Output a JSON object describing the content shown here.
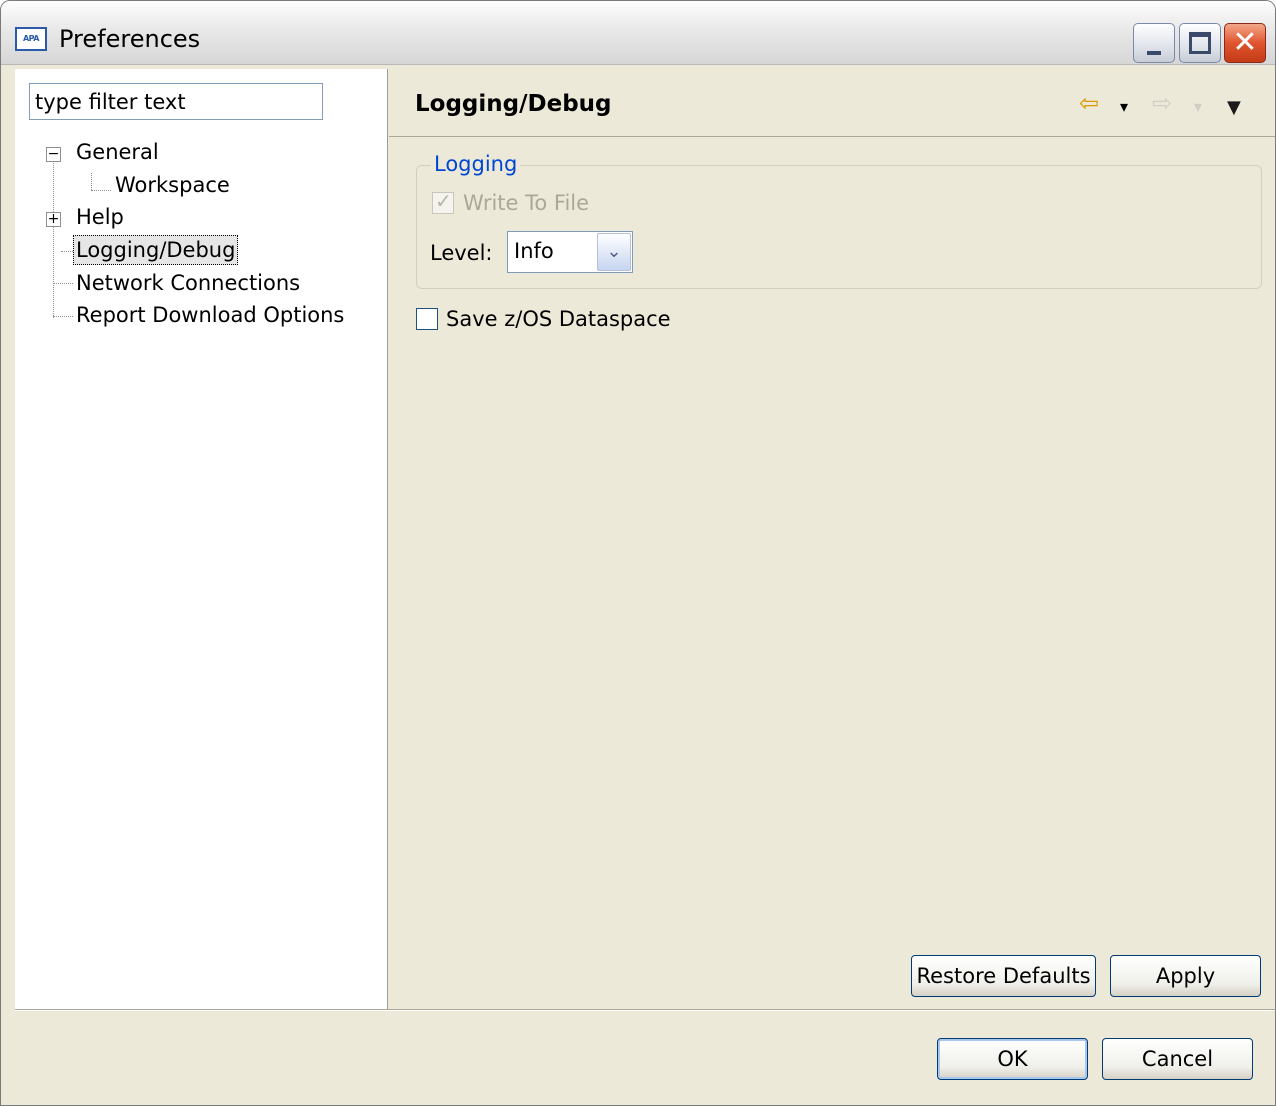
{
  "window": {
    "title": "Preferences",
    "icon_text": "APA",
    "controls": {
      "minimize": "_",
      "maximize": "□",
      "close": "✕"
    }
  },
  "filter": {
    "placeholder": "type filter text",
    "value": "type filter text"
  },
  "tree": {
    "expanded_glyph": "−",
    "collapsed_glyph": "+",
    "items": [
      {
        "label": "General",
        "expanded": true
      },
      {
        "label": "Workspace"
      },
      {
        "label": "Help",
        "expanded": false
      },
      {
        "label": "Logging/Debug",
        "selected": true
      },
      {
        "label": "Network Connections"
      },
      {
        "label": "Report Download Options"
      }
    ]
  },
  "page": {
    "title": "Logging/Debug",
    "nav": {
      "back": "⇦",
      "forward": "⇨",
      "menu": "▼",
      "back_menu": "▾",
      "forward_menu": "▾"
    },
    "logging_group": {
      "label": "Logging",
      "write_to_file": {
        "label": "Write To File",
        "checked": true,
        "enabled": false,
        "mark": "✓"
      },
      "level": {
        "label": "Level:",
        "value": "Info",
        "arrow": "⌄"
      }
    },
    "save_dataspace": {
      "label": "Save z/OS Dataspace",
      "checked": false
    },
    "restore_defaults": "Restore Defaults",
    "apply": "Apply"
  },
  "dialog": {
    "ok": "OK",
    "cancel": "Cancel"
  },
  "colors": {
    "accent": "#0046d5",
    "panel": "#ece9d8",
    "close_red": "#e0552f"
  }
}
